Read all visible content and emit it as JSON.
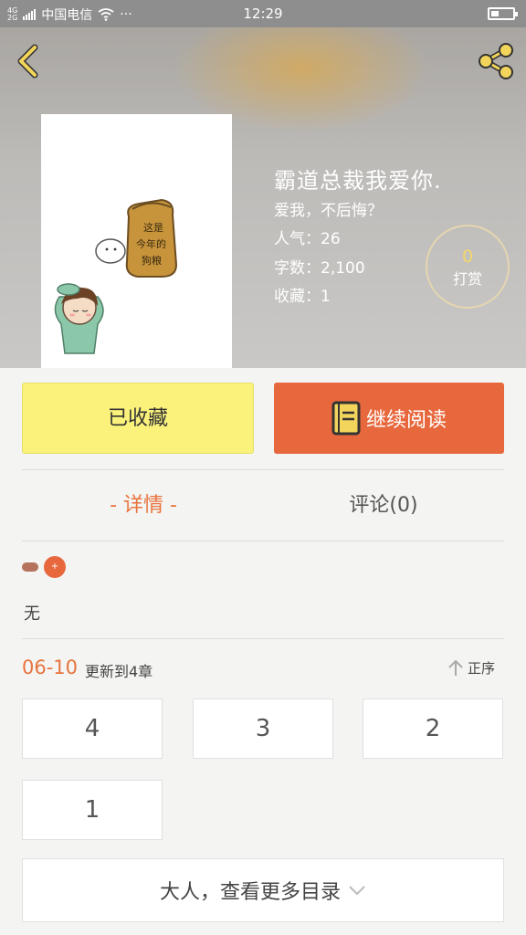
{
  "status_bar": {
    "network_top": "4G",
    "network_bottom": "2G",
    "carrier": "中国电信",
    "dots": "···",
    "time": "12:29"
  },
  "header": {
    "icons": {
      "back": "chevron-left-icon",
      "share": "share-icon"
    },
    "accent_color": "#f2d55a"
  },
  "cover": {
    "sign_text": "这是今年的狗粮"
  },
  "book": {
    "title": "霸道总裁我爱你.",
    "subtitle": "爱我，不后悔？",
    "popularity": "人气：26",
    "word_count": "字数：2,100",
    "favorites": "收藏：1"
  },
  "tip": {
    "count": "0",
    "label": "打赏"
  },
  "actions": {
    "collect_label": "已收藏",
    "read_label": "继续阅读",
    "collect_color": "#fbf27c",
    "read_color": "#e8683d"
  },
  "tabs": {
    "detail": "- 详情 -",
    "comments": "评论(0)"
  },
  "tags": {
    "add": "+"
  },
  "description": "无",
  "updates": {
    "date": "06-10",
    "text": "更新到4章",
    "sort_label": "正序"
  },
  "chapters": [
    "4",
    "3",
    "2",
    "1"
  ],
  "more_label": "大人，查看更多目录"
}
